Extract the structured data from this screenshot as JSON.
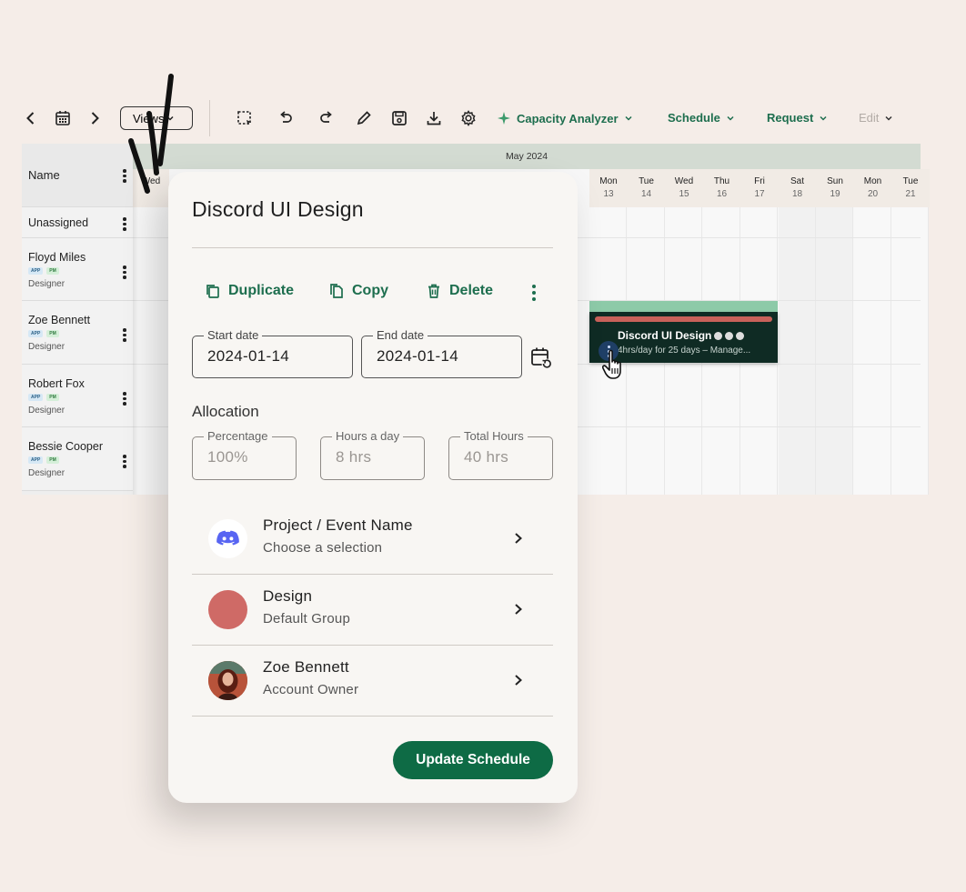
{
  "toolbar": {
    "views_label": "Views",
    "menus": [
      {
        "label": "Capacity Analyzer",
        "icon": "sparkle-icon"
      },
      {
        "label": "Schedule"
      },
      {
        "label": "Request"
      },
      {
        "label": "Edit",
        "disabled": true
      }
    ]
  },
  "scheduler": {
    "name_header": "Name",
    "month": "May 2024",
    "partial_day_label": "Wed",
    "days": [
      {
        "name": "Mon",
        "date": "13"
      },
      {
        "name": "Tue",
        "date": "14"
      },
      {
        "name": "Wed",
        "date": "15"
      },
      {
        "name": "Thu",
        "date": "16"
      },
      {
        "name": "Fri",
        "date": "17"
      },
      {
        "name": "Sat",
        "date": "18"
      },
      {
        "name": "Sun",
        "date": "19"
      },
      {
        "name": "Mon",
        "date": "20"
      },
      {
        "name": "Tue",
        "date": "21"
      }
    ],
    "resources": [
      {
        "name": "Unassigned"
      },
      {
        "name": "Floyd Miles",
        "badges": [
          "APP",
          "PM"
        ],
        "role": "Designer"
      },
      {
        "name": "Zoe Bennett",
        "badges": [
          "APP",
          "PM"
        ],
        "role": "Designer"
      },
      {
        "name": "Robert Fox",
        "badges": [
          "APP",
          "PM"
        ],
        "role": "Designer"
      },
      {
        "name": "Bessie Cooper",
        "badges": [
          "APP",
          "PM"
        ],
        "role": "Designer"
      }
    ],
    "event": {
      "title": "Discord UI Design",
      "subtitle": "4hrs/day for 25 days – Manage..."
    }
  },
  "modal": {
    "title": "Discord UI Design",
    "actions": {
      "duplicate": "Duplicate",
      "copy": "Copy",
      "delete": "Delete"
    },
    "start_date": {
      "label": "Start date",
      "value": "2024-01-14"
    },
    "end_date": {
      "label": "End date",
      "value": "2024-01-14"
    },
    "allocation_heading": "Allocation",
    "allocation": {
      "percentage": {
        "label": "Percentage",
        "placeholder": "100%"
      },
      "hours_day": {
        "label": "Hours a day",
        "placeholder": "8 hrs"
      },
      "total_hours": {
        "label": "Total Hours",
        "placeholder": "40 hrs"
      }
    },
    "rows": [
      {
        "title": "Project / Event Name",
        "subtitle": "Choose a selection",
        "icon": "discord-icon"
      },
      {
        "title": "Design",
        "subtitle": "Default Group",
        "color": "#cf6a66"
      },
      {
        "title": "Zoe Bennett",
        "subtitle": "Account Owner"
      }
    ],
    "update_button": "Update Schedule"
  },
  "colors": {
    "brand_green": "#0e6b45",
    "accent_text": "#1d6e4e",
    "event_bg": "#0f2b24",
    "event_top": "#8dcaa8",
    "event_bar": "#c8615a"
  }
}
